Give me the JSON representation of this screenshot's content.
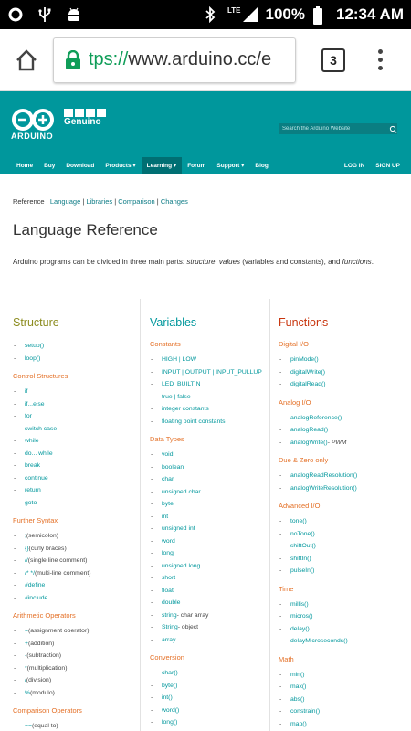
{
  "status_bar": {
    "battery": "100%",
    "time": "12:34 AM",
    "network": "LTE"
  },
  "browser": {
    "url_proto": "tps://",
    "url_host": "www.arduino.cc/e",
    "tab_count": "3"
  },
  "header": {
    "logo_text": "ARDUINO",
    "sub_brand": "Genuino",
    "search_placeholder": "Search the Arduino Website",
    "nav": [
      "Home",
      "Buy",
      "Download",
      "Products ▾",
      "Learning ▾",
      "Forum",
      "Support ▾",
      "Blog"
    ],
    "nav_active": "Learning ▾",
    "login": "LOG IN",
    "signup": "SIGN UP"
  },
  "breadcrumb": {
    "current": "Reference",
    "links": [
      "Language",
      "Libraries",
      "Comparison",
      "Changes"
    ]
  },
  "page_title": "Language Reference",
  "intro": {
    "pre": "Arduino programs can be divided in three main parts: ",
    "structure": "structure",
    "comma": ", ",
    "values": "values",
    "mid": " (variables and constants), and ",
    "functions": "functions",
    "end": "."
  },
  "columns": [
    {
      "title": "Structure",
      "color": "#8c8c1f",
      "groups": [
        {
          "heading": "",
          "items": [
            {
              "label": "setup()"
            },
            {
              "label": "loop()"
            }
          ]
        },
        {
          "heading": "Control Structures",
          "items": [
            {
              "label": "if"
            },
            {
              "label": "if...else"
            },
            {
              "label": "for"
            },
            {
              "label": "switch case"
            },
            {
              "label": "while"
            },
            {
              "label": "do... while"
            },
            {
              "label": "break"
            },
            {
              "label": "continue"
            },
            {
              "label": "return"
            },
            {
              "label": "goto"
            }
          ]
        },
        {
          "heading": "Further Syntax",
          "items": [
            {
              "label": ";",
              "note": " (semicolon)"
            },
            {
              "label": "{}",
              "note": " (curly braces)"
            },
            {
              "label": "//",
              "note": " (single line comment)"
            },
            {
              "label": "/* */",
              "note": " (multi-line comment)"
            },
            {
              "label": "#define"
            },
            {
              "label": "#include"
            }
          ]
        },
        {
          "heading": "Arithmetic Operators",
          "items": [
            {
              "label": "=",
              "note": " (assignment operator)"
            },
            {
              "label": "+",
              "note": " (addition)"
            },
            {
              "label": "-",
              "note": " (subtraction)"
            },
            {
              "label": "*",
              "note": " (multiplication)"
            },
            {
              "label": "/",
              "note": " (division)"
            },
            {
              "label": "%",
              "note": " (modulo)"
            }
          ]
        },
        {
          "heading": "Comparison Operators",
          "items": [
            {
              "label": "==",
              "note": " (equal to)"
            }
          ]
        }
      ]
    },
    {
      "title": "Variables",
      "color": "#00979c",
      "groups": [
        {
          "heading": "Constants",
          "items": [
            {
              "label": "HIGH | LOW"
            },
            {
              "label": "INPUT | OUTPUT | INPUT_PULLUP"
            },
            {
              "label": "LED_BUILTIN"
            },
            {
              "label": "true | false"
            },
            {
              "label": "integer constants"
            },
            {
              "label": "floating point constants"
            }
          ]
        },
        {
          "heading": "Data Types",
          "items": [
            {
              "label": "void"
            },
            {
              "label": "boolean"
            },
            {
              "label": "char"
            },
            {
              "label": "unsigned char"
            },
            {
              "label": "byte"
            },
            {
              "label": "int"
            },
            {
              "label": "unsigned int"
            },
            {
              "label": "word"
            },
            {
              "label": "long"
            },
            {
              "label": "unsigned long"
            },
            {
              "label": "short"
            },
            {
              "label": "float"
            },
            {
              "label": "double"
            },
            {
              "label": "string",
              "note": " - char array"
            },
            {
              "label": "String",
              "note": " - object"
            },
            {
              "label": "array"
            }
          ]
        },
        {
          "heading": "Conversion",
          "items": [
            {
              "label": "char()"
            },
            {
              "label": "byte()"
            },
            {
              "label": "int()"
            },
            {
              "label": "word()"
            },
            {
              "label": "long()"
            }
          ]
        }
      ]
    },
    {
      "title": "Functions",
      "color": "#c8350d",
      "groups": [
        {
          "heading": "Digital I/O",
          "items": [
            {
              "label": "pinMode()"
            },
            {
              "label": "digitalWrite()"
            },
            {
              "label": "digitalRead()"
            }
          ]
        },
        {
          "heading": "Analog I/O",
          "items": [
            {
              "label": "analogReference()"
            },
            {
              "label": "analogRead()"
            },
            {
              "label": "analogWrite()",
              "note_em": " - PWM"
            }
          ]
        },
        {
          "heading": "Due & Zero only",
          "items": [
            {
              "label": "analogReadResolution()"
            },
            {
              "label": "analogWriteResolution()"
            }
          ]
        },
        {
          "heading": "Advanced I/O",
          "items": [
            {
              "label": "tone()"
            },
            {
              "label": "noTone()"
            },
            {
              "label": "shiftOut()"
            },
            {
              "label": "shiftIn()"
            },
            {
              "label": "pulseIn()"
            }
          ]
        },
        {
          "heading": "Time",
          "items": [
            {
              "label": "millis()"
            },
            {
              "label": "micros()"
            },
            {
              "label": "delay()"
            },
            {
              "label": "delayMicroseconds()"
            }
          ]
        },
        {
          "heading": "Math",
          "items": [
            {
              "label": "min()"
            },
            {
              "label": "max()"
            },
            {
              "label": "abs()"
            },
            {
              "label": "constrain()"
            },
            {
              "label": "map()"
            }
          ]
        }
      ]
    }
  ]
}
